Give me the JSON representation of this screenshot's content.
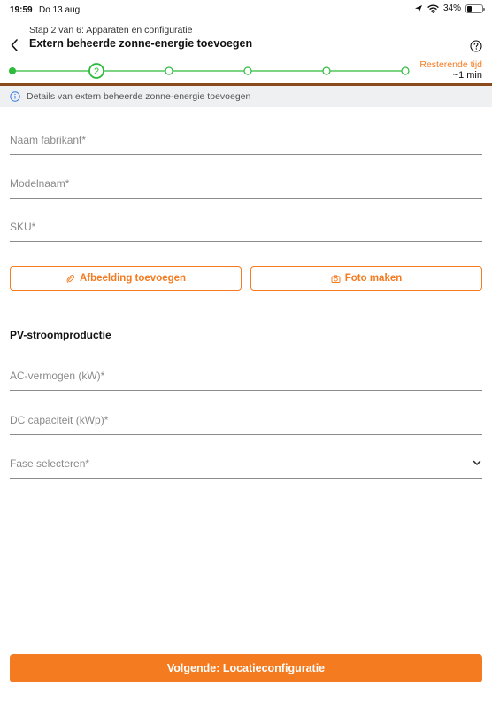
{
  "status_bar": {
    "time": "19:59",
    "date": "Do 13 aug",
    "battery": "34%",
    "battery_level": 0.34,
    "icons": [
      "location-arrow-icon",
      "wifi-icon",
      "battery-icon"
    ]
  },
  "header": {
    "step": "Stap 2 van 6: Apparaten en configuratie",
    "title": "Extern beheerde zonne-energie toevoegen",
    "back_icon": "chevron-left-icon",
    "help_icon": "help-icon"
  },
  "progress": {
    "current_step": 2,
    "total_steps": 6,
    "current_label": "2",
    "remaining_label": "Resterende tijd",
    "remaining_value": "~1 min"
  },
  "info": {
    "icon": "info-icon",
    "text": "Details van extern beheerde zonne-energie toevoegen"
  },
  "form": {
    "manufacturer": {
      "label": "Naam fabrikant*",
      "value": ""
    },
    "model": {
      "label": "Modelnaam*",
      "value": ""
    },
    "sku": {
      "label": "SKU*",
      "value": ""
    },
    "add_image_label": "Afbeelding toevoegen",
    "add_image_icon": "paperclip-icon",
    "take_photo_label": "Foto maken",
    "take_photo_icon": "camera-icon"
  },
  "pv": {
    "title": "PV-stroomproductie",
    "ac_power": {
      "label": "AC-vermogen (kW)*",
      "value": ""
    },
    "dc_capacity": {
      "label": "DC capaciteit (kWp)*",
      "value": ""
    },
    "phase": {
      "label": "Fase selecteren*",
      "value": "",
      "icon": "chevron-down-icon"
    }
  },
  "footer": {
    "next_label": "Volgende: Locatieconfiguratie"
  },
  "colors": {
    "accent": "#f47b20",
    "progress_green": "#2dbb3c",
    "divider_brown": "#8a4a1c"
  }
}
